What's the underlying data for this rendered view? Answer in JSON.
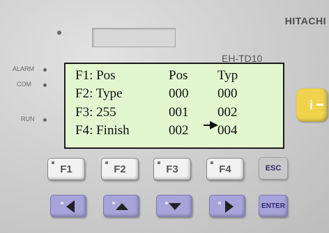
{
  "device": {
    "brand": "HITACHI",
    "model": "EH-TD10"
  },
  "indicators": {
    "alarm": "ALARM",
    "com": "COM",
    "run": "RUN"
  },
  "lcd": {
    "rows": [
      [
        "F1: Pos",
        "Pos",
        "Typ"
      ],
      [
        "F2: Type",
        "000",
        "000"
      ],
      [
        "F3: 255",
        "001",
        "002"
      ],
      [
        "F4: Finish",
        "002",
        "004"
      ]
    ],
    "cursor_row": 2,
    "colors": {
      "background": "#e2f7d0",
      "text": "#111111"
    }
  },
  "keys": {
    "f1": "F1",
    "f2": "F2",
    "f3": "F3",
    "f4": "F4",
    "esc": "ESC",
    "enter": "ENTER",
    "info": "i",
    "left": "left-arrow-icon",
    "up": "up-arrow-icon",
    "down": "down-arrow-icon",
    "right": "right-arrow-icon"
  },
  "colors": {
    "panel": "#d0d0d0",
    "nav_keys": "#a7a4da",
    "info_key": "#f0d24c"
  }
}
